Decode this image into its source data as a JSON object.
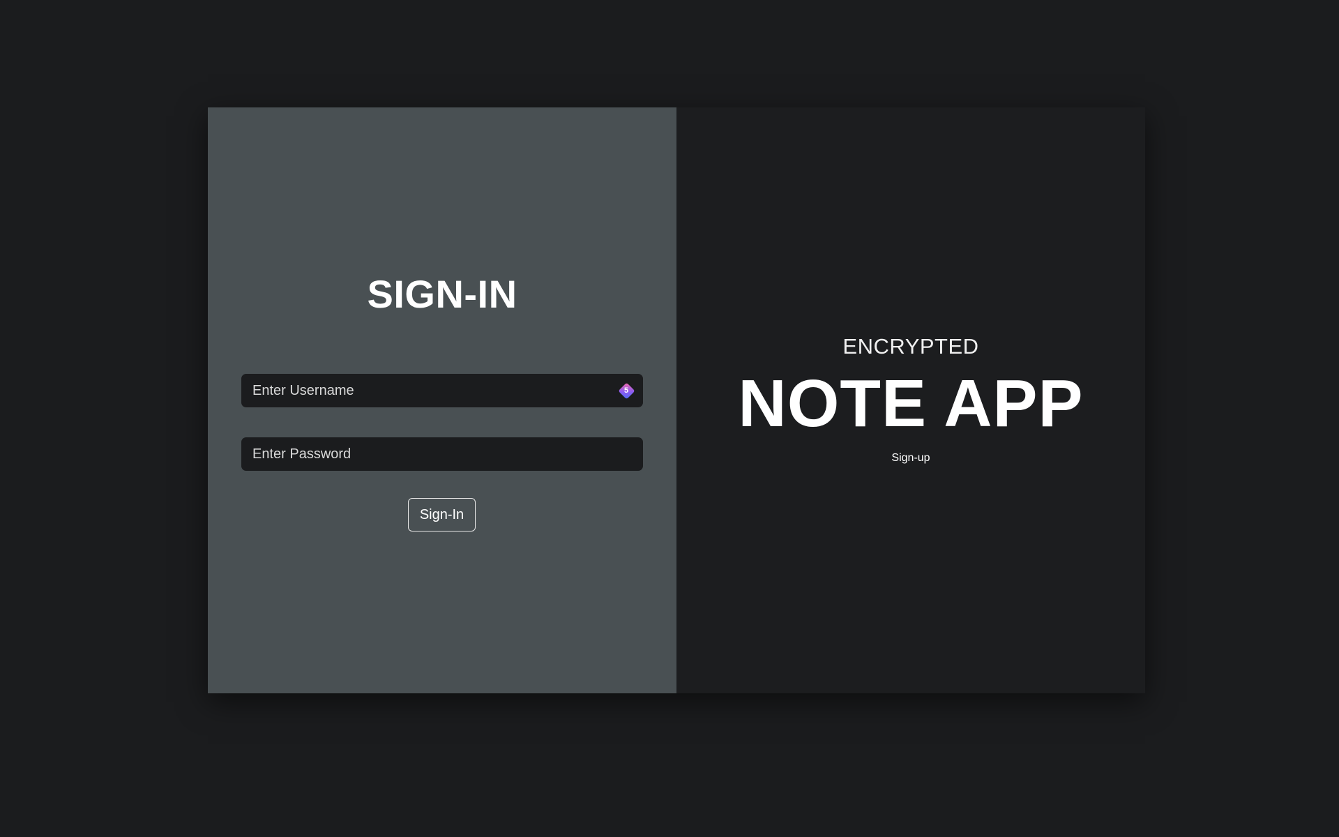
{
  "signin_panel": {
    "title": "SIGN-IN",
    "username": {
      "placeholder": "Enter Username",
      "value": "",
      "extension_badge_count": "5"
    },
    "password": {
      "placeholder": "Enter Password",
      "value": ""
    },
    "submit_label": "Sign-In"
  },
  "brand_panel": {
    "subtitle": "ENCRYPTED",
    "title": "NOTE APP",
    "signup_link": "Sign-up"
  },
  "colors": {
    "page_background": "#1b1c1e",
    "signin_panel_background": "#495053",
    "brand_panel_background": "#1c1d1f",
    "input_background": "#1b1c1e",
    "text": "#ffffff"
  },
  "icons": {
    "extension_badge": "password-manager-extension-icon"
  }
}
